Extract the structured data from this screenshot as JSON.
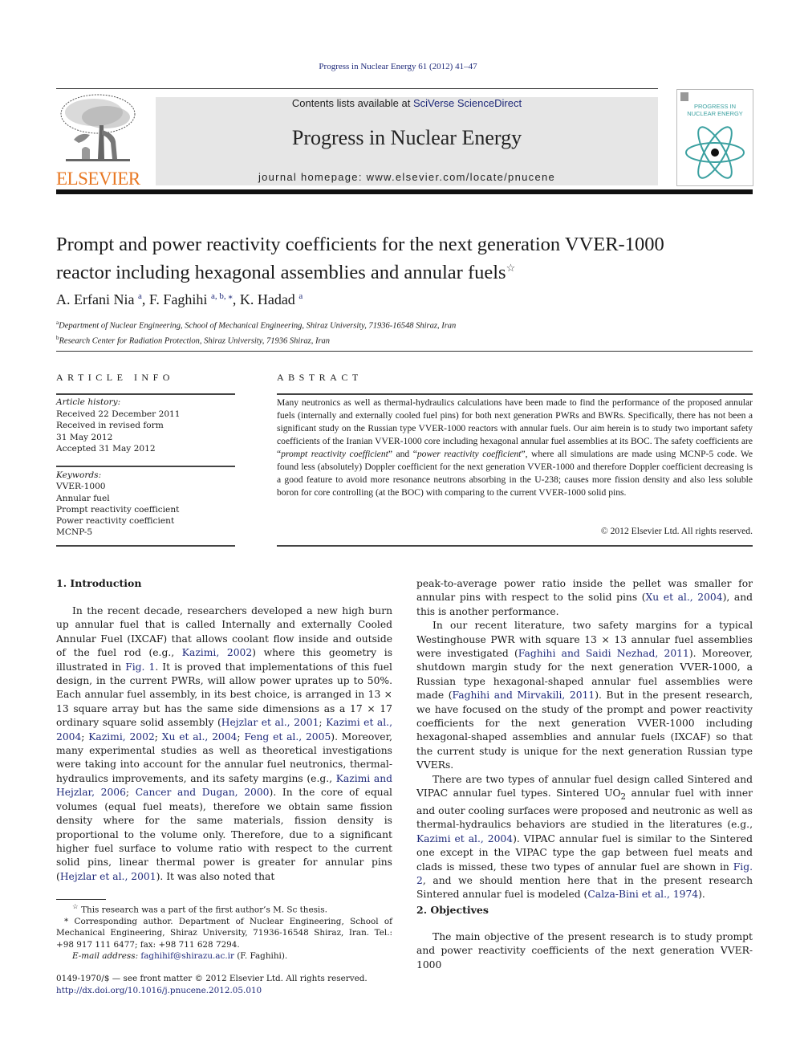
{
  "header": {
    "citation": "Progress in Nuclear Energy 61 (2012) 41–47",
    "contents_prefix": "Contents lists available at ",
    "contents_link": "SciVerse ScienceDirect",
    "journal_name": "Progress in Nuclear Energy",
    "homepage": "journal homepage: www.elsevier.com/locate/pnucene",
    "publisher_logo_text": "ELSEVIER",
    "cover_title_line1": "PROGRESS IN",
    "cover_title_line2": "NUCLEAR ENERGY",
    "brand_color": "#e87722",
    "link_color": "#1f2a7a",
    "cover_accent_color": "#3aa0a0"
  },
  "article": {
    "title_line1": "Prompt and power reactivity coefficients for the next generation VVER-1000",
    "title_line2": "reactor including hexagonal assemblies and annular fuels",
    "title_mark": "☆",
    "authors": [
      {
        "name": "A. Erfani Nia",
        "sup": "a",
        "sep": ", "
      },
      {
        "name": "F. Faghihi",
        "sup": "a, b, ⁎",
        "sep": ", "
      },
      {
        "name": "K. Hadad",
        "sup": "a",
        "sep": ""
      }
    ],
    "affiliations": [
      {
        "mark": "a",
        "text": "Department of Nuclear Engineering, School of Mechanical Engineering, Shiraz University, 71936-16548 Shiraz, Iran"
      },
      {
        "mark": "b",
        "text": "Research Center for Radiation Protection, Shiraz University, 71936 Shiraz, Iran"
      }
    ]
  },
  "article_info": {
    "heading": "ARTICLE INFO",
    "history_label": "Article history:",
    "history": [
      "Received 22 December 2011",
      "Received in revised form",
      "31 May 2012",
      "Accepted 31 May 2012"
    ],
    "keywords_label": "Keywords:",
    "keywords": [
      "VVER-1000",
      "Annular fuel",
      "Prompt reactivity coefficient",
      "Power reactivity coefficient",
      "MCNP-5"
    ]
  },
  "abstract": {
    "heading": "ABSTRACT",
    "part1": "Many neutronics as well as thermal-hydraulics calculations have been made to find the performance of the proposed annular fuels (internally and externally cooled fuel pins) for both next generation PWRs and BWRs. Specifically, there has not been a significant study on the Russian type VVER-1000 reactors with annular fuels. Our aim herein is to study two important safety coefficients of the Iranian VVER-1000 core including hexagonal annular fuel assemblies at its BOC. The safety coefficients are “",
    "italic1": "prompt reactivity coefficient",
    "part2": "” and “",
    "italic2": "power reactivity coefficient",
    "part3": "”, where all simulations are made using MCNP-5 code. We found less (absolutely) Doppler coefficient for the next generation VVER-1000 and therefore Doppler coefficient decreasing is a good feature to avoid more resonance neutrons absorbing in the U-238; causes more fission density and also less soluble boron for core controlling (at the BOC) with comparing to the current VVER-1000 solid pins.",
    "copyright": "© 2012 Elsevier Ltd. All rights reserved."
  },
  "sections": {
    "s1_title": "1.  Introduction",
    "s1_p1": [
      {
        "t": "In the recent decade, researchers developed a new high burn up annular fuel that is called Internally and externally Cooled Annular Fuel (IXCAF) that allows coolant flow inside and outside of the fuel rod (e.g., "
      },
      {
        "link": "Kazimi, 2002"
      },
      {
        "t": ") where this geometry is illustrated in "
      },
      {
        "link": "Fig. 1"
      },
      {
        "t": ". It is proved that implementations of this fuel design, in the current PWRs, will allow power uprates up to 50%. Each annular fuel assembly, in its best choice, is arranged in 13 × 13 square array but has the same side dimensions as a 17 × 17 ordinary square solid assembly ("
      },
      {
        "link": "Hejzlar et al., 2001"
      },
      {
        "t": "; "
      },
      {
        "link": "Kazimi et al., 2004"
      },
      {
        "t": "; "
      },
      {
        "link": "Kazimi, 2002"
      },
      {
        "t": "; "
      },
      {
        "link": "Xu et al., 2004"
      },
      {
        "t": "; "
      },
      {
        "link": "Feng et al., 2005"
      },
      {
        "t": "). Moreover, many experimental studies as well as theoretical investigations were taking into account for the annular fuel neutronics, thermal-hydraulics improvements, and its safety margins (e.g., "
      },
      {
        "link": "Kazimi and Hejzlar, 2006"
      },
      {
        "t": "; "
      },
      {
        "link": "Cancer and Dugan, 2000"
      },
      {
        "t": "). In the core of equal volumes (equal fuel meats), therefore we obtain same fission density where for the same materials, fission density is proportional to the volume only. Therefore, due to a significant higher fuel surface to volume ratio with respect to the current solid pins, linear thermal power is greater for annular pins ("
      },
      {
        "link": "Hejzlar et al., 2001"
      },
      {
        "t": "). It was also noted that"
      }
    ],
    "s1_p1_cont": [
      {
        "t": "peak-to-average power ratio inside the pellet was smaller for annular pins with respect to the solid pins ("
      },
      {
        "link": "Xu et al., 2004"
      },
      {
        "t": "), and this is another performance."
      }
    ],
    "s1_p2": [
      {
        "t": "In our recent literature, two safety margins for a typical Westinghouse PWR with square 13 × 13 annular fuel assemblies were investigated ("
      },
      {
        "link": "Faghihi and Saidi Nezhad, 2011"
      },
      {
        "t": "). Moreover, shutdown margin study for the next generation VVER-1000, a Russian type hexagonal-shaped annular fuel assemblies were made ("
      },
      {
        "link": "Faghihi and Mirvakili, 2011"
      },
      {
        "t": "). But in the present research, we have focused on the study of the prompt and power reactivity coefficients for the next generation VVER-1000 including hexagonal-shaped assemblies and annular fuels (IXCAF) so that the current study is unique for the next generation Russian type VVERs."
      }
    ],
    "s1_p3": [
      {
        "t": "There are two types of annular fuel design called Sintered and VIPAC annular fuel types. Sintered UO"
      },
      {
        "sub": "2"
      },
      {
        "t": " annular fuel with inner and outer cooling surfaces were proposed and neutronic as well as thermal-hydraulics behaviors are studied in the literatures (e.g., "
      },
      {
        "link": "Kazimi et al., 2004"
      },
      {
        "t": "). VIPAC annular fuel is similar to the Sintered one except in the VIPAC type the gap between fuel meats and clads is missed, these two types of annular fuel are shown in "
      },
      {
        "link": "Fig. 2"
      },
      {
        "t": ", and we should mention here that in the present research Sintered annular fuel is modeled ("
      },
      {
        "link": "Calza-Bini et al., 1974"
      },
      {
        "t": ")."
      }
    ],
    "s2_title": "2.  Objectives",
    "s2_p1": [
      {
        "t": "The main objective of the present research is to study prompt and power reactivity coefficients of the next generation VVER-1000"
      }
    ]
  },
  "footnotes": {
    "star_mark": "☆",
    "star_text": "This research was a part of the first author’s M. Sc thesis.",
    "corr_mark": "*",
    "corr_text": "Corresponding author. Department of Nuclear Engineering, School of Mechanical Engineering, Shiraz University, 71936-16548 Shiraz, Iran. Tel.: +98 917 111 6477; fax: +98 711 628 7294.",
    "email_label": "E-mail address: ",
    "email": "faghihif@shirazu.ac.ir",
    "email_suffix": " (F. Faghihi).",
    "front_matter": "0149-1970/$ — see front matter © 2012 Elsevier Ltd. All rights reserved.",
    "doi": "http://dx.doi.org/10.1016/j.pnucene.2012.05.010"
  }
}
